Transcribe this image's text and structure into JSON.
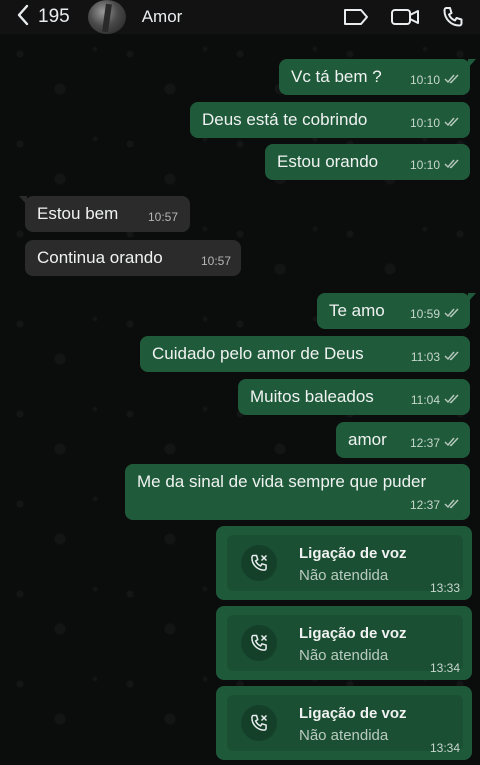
{
  "header": {
    "unread_count": "195",
    "contact_name": "Amor",
    "icons": [
      "back-chevron-icon",
      "label-icon",
      "video-call-icon",
      "voice-call-icon"
    ]
  },
  "messages": [
    {
      "dir": "out",
      "text": "Vc tá bem ?",
      "time": "10:10",
      "ticks": true
    },
    {
      "dir": "out",
      "text": "Deus está te cobrindo",
      "time": "10:10",
      "ticks": true
    },
    {
      "dir": "out",
      "text": "Estou orando",
      "time": "10:10",
      "ticks": true
    },
    {
      "dir": "in",
      "text": "Estou bem",
      "time": "10:57"
    },
    {
      "dir": "in",
      "text": "Continua orando",
      "time": "10:57"
    },
    {
      "dir": "out",
      "text": "Te amo",
      "time": "10:59",
      "ticks": true
    },
    {
      "dir": "out",
      "text": "Cuidado pelo amor de Deus",
      "time": "11:03",
      "ticks": true
    },
    {
      "dir": "out",
      "text": "Muitos baleados",
      "time": "11:04",
      "ticks": true
    },
    {
      "dir": "out",
      "text": "amor",
      "time": "12:37",
      "ticks": true
    },
    {
      "dir": "out",
      "text": "Me da sinal de vida sempre que puder",
      "time": "12:37",
      "ticks": true
    }
  ],
  "calls": [
    {
      "title": "Ligação de voz",
      "status": "Não atendida",
      "time": "13:33"
    },
    {
      "title": "Ligação de voz",
      "status": "Não atendida",
      "time": "13:34"
    },
    {
      "title": "Ligação de voz",
      "status": "Não atendida",
      "time": "13:34"
    }
  ],
  "colors": {
    "outgoing_bubble": "#1f5b3b",
    "incoming_bubble": "#2b2b2b",
    "background": "#0b0d0c"
  }
}
